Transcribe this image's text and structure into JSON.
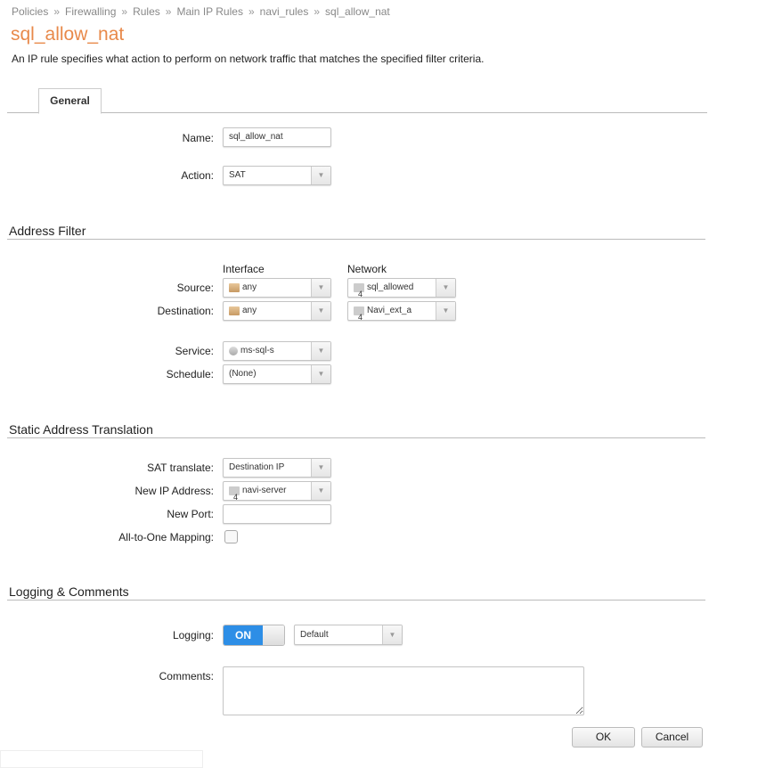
{
  "breadcrumb": [
    "Policies",
    "Firewalling",
    "Rules",
    "Main IP Rules",
    "navi_rules",
    "sql_allow_nat"
  ],
  "breadcrumb_sep": "»",
  "title": "sql_allow_nat",
  "description": "An IP rule specifies what action to perform on network traffic that matches the specified filter criteria.",
  "tabs": [
    {
      "label": "General",
      "active": true
    }
  ],
  "general": {
    "name_label": "Name:",
    "name_value": "sql_allow_nat",
    "action_label": "Action:",
    "action_value": "SAT"
  },
  "address_filter": {
    "heading": "Address Filter",
    "interface_header": "Interface",
    "network_header": "Network",
    "source_label": "Source:",
    "source_interface": "any",
    "source_network": "sql_allowed",
    "destination_label": "Destination:",
    "destination_interface": "any",
    "destination_network": "Navi_ext_a",
    "service_label": "Service:",
    "service_value": "ms-sql-s",
    "schedule_label": "Schedule:",
    "schedule_value": "(None)",
    "net_badge": "4"
  },
  "sat": {
    "heading": "Static Address Translation",
    "translate_label": "SAT translate:",
    "translate_value": "Destination IP",
    "new_ip_label": "New IP Address:",
    "new_ip_value": "navi-server",
    "new_port_label": "New Port:",
    "new_port_value": "",
    "all_to_one_label": "All-to-One Mapping:",
    "all_to_one_checked": false
  },
  "logging": {
    "heading": "Logging & Comments",
    "logging_label": "Logging:",
    "toggle_label": "ON",
    "toggle_on": true,
    "severity_value": "Default",
    "comments_label": "Comments:",
    "comments_value": ""
  },
  "buttons": {
    "ok": "OK",
    "cancel": "Cancel"
  },
  "colors": {
    "title": "#e8894a",
    "toggle_on": "#2d8ee6"
  }
}
